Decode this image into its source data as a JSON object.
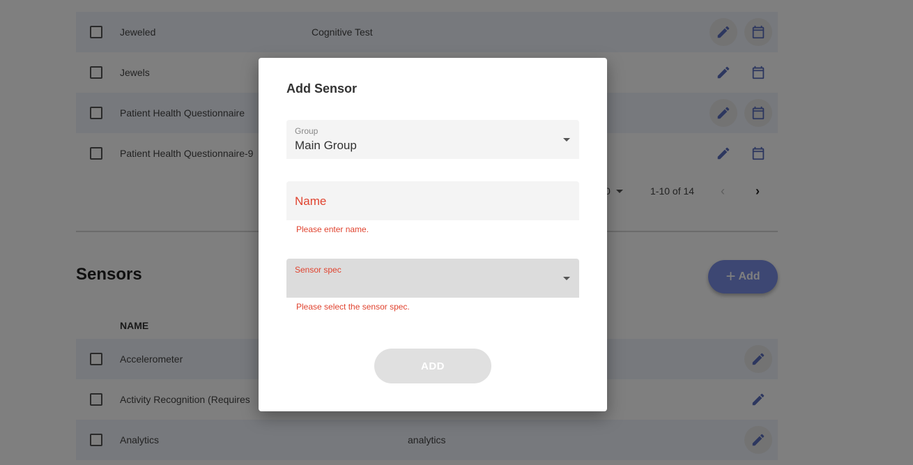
{
  "activities": {
    "rows": [
      {
        "name": "Jeweled",
        "type": "Cognitive Test"
      },
      {
        "name": "Jewels",
        "type": ""
      },
      {
        "name": "Patient Health Questionnaire",
        "type": ""
      },
      {
        "name": "Patient Health Questionnaire-9",
        "type": ""
      }
    ],
    "pagination": {
      "rows_per_page_fragment": "0",
      "range": "1-10 of 14"
    }
  },
  "sensors": {
    "title": "Sensors",
    "add_label": "Add",
    "column_name": "NAME",
    "rows": [
      {
        "name": "Accelerometer",
        "spec": ""
      },
      {
        "name": "Activity Recognition (Requires",
        "spec": ""
      },
      {
        "name": "Analytics",
        "spec": "analytics"
      }
    ]
  },
  "dialog": {
    "title": "Add Sensor",
    "group": {
      "label": "Group",
      "value": "Main Group"
    },
    "name": {
      "placeholder": "Name",
      "error": "Please enter name."
    },
    "sensor_spec": {
      "label": "Sensor spec",
      "error": "Please select the sensor spec."
    },
    "submit_label": "ADD"
  },
  "colors": {
    "accent": "#5a6fbf",
    "fab": "#7b8fe6",
    "error": "#e0432f"
  },
  "icons": {
    "edit": "pencil-icon",
    "schedule": "calendar-icon",
    "prev": "chevron-left-icon",
    "next": "chevron-right-icon",
    "dropdown": "caret-down-icon",
    "add": "plus-icon"
  }
}
